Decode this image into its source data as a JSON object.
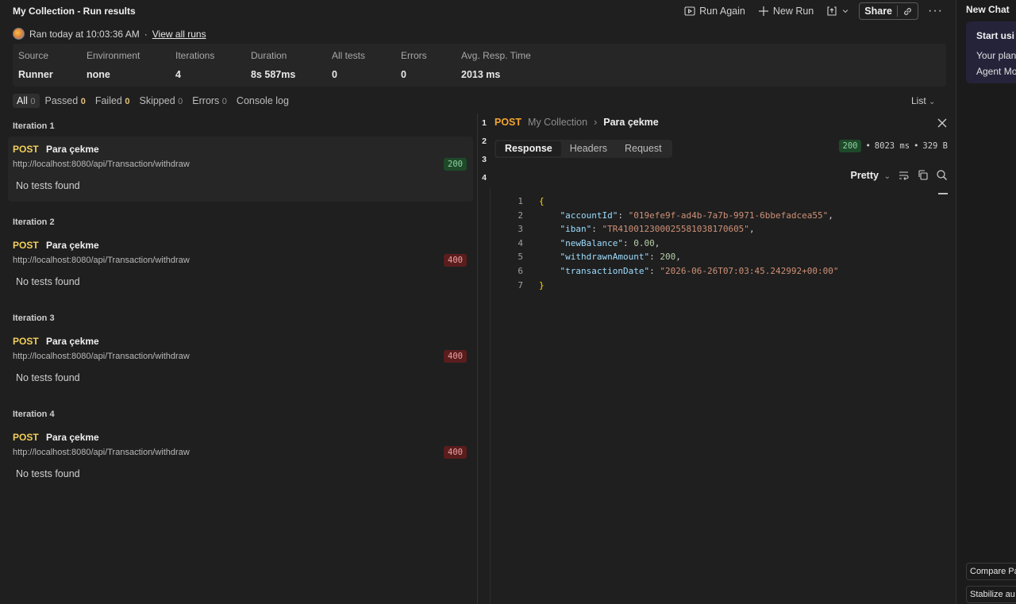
{
  "header": {
    "title": "My Collection - Run results",
    "run_again": "Run Again",
    "new_run": "New Run",
    "share": "Share",
    "more": "···"
  },
  "run": {
    "ran": "Ran today at 10:03:36 AM",
    "sep": "·",
    "view_all": "View all runs"
  },
  "stats": {
    "labels": [
      "Source",
      "Environment",
      "Iterations",
      "Duration",
      "All tests",
      "Errors",
      "Avg. Resp. Time"
    ],
    "values": [
      "Runner",
      "none",
      "4",
      "8s 587ms",
      "0",
      "0",
      "2013 ms"
    ]
  },
  "filters": {
    "all": "All",
    "all_count": "0",
    "passed": "Passed",
    "passed_count": "0",
    "failed": "Failed",
    "failed_count": "0",
    "skipped": "Skipped",
    "skipped_count": "0",
    "errors": "Errors",
    "errors_count": "0",
    "console": "Console log",
    "view": "List"
  },
  "iterations": [
    {
      "title": "Iteration 1",
      "method": "POST",
      "name": "Para çekme",
      "url": "http://localhost:8080/api/Transaction/withdraw",
      "status": "200",
      "tests": "No tests found"
    },
    {
      "title": "Iteration 2",
      "method": "POST",
      "name": "Para çekme",
      "url": "http://localhost:8080/api/Transaction/withdraw",
      "status": "400",
      "tests": "No tests found"
    },
    {
      "title": "Iteration 3",
      "method": "POST",
      "name": "Para çekme",
      "url": "http://localhost:8080/api/Transaction/withdraw",
      "status": "400",
      "tests": "No tests found"
    },
    {
      "title": "Iteration 4",
      "method": "POST",
      "name": "Para çekme",
      "url": "http://localhost:8080/api/Transaction/withdraw",
      "status": "400",
      "tests": "No tests found"
    }
  ],
  "nav_numbers": [
    "1",
    "2",
    "3",
    "4"
  ],
  "detail": {
    "method": "POST",
    "collection": "My Collection",
    "chevron": "›",
    "name": "Para çekme",
    "tabs": [
      "Response",
      "Headers",
      "Request"
    ],
    "status": "200",
    "time": "8023 ms",
    "size": "329 B",
    "bullet": "•",
    "format": "Pretty",
    "body": {
      "l1": "{",
      "accountId_key": "\"accountId\"",
      "accountId_val": "\"019efe9f-ad4b-7a7b-9971-6bbefadcea55\"",
      "iban_key": "\"iban\"",
      "iban_val": "\"TR410012300025581038170605\"",
      "newBalance_key": "\"newBalance\"",
      "newBalance_val": "0.00",
      "withdrawnAmount_key": "\"withdrawnAmount\"",
      "withdrawnAmount_val": "200",
      "transactionDate_key": "\"transactionDate\"",
      "transactionDate_val": "\"2026-06-26T07:03:45.242992+00:00\"",
      "l7": "}"
    }
  },
  "side": {
    "new_chat": "New Chat",
    "card_title": "Start usi",
    "card_line1": "Your plan",
    "card_line2": "Agent Mo",
    "sugg1": "Compare Pa",
    "sugg2": "Stabilize au"
  }
}
